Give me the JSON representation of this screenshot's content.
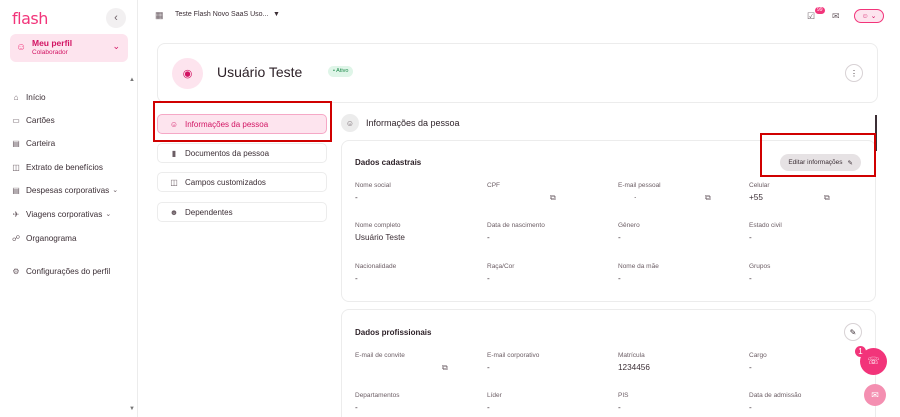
{
  "sidebar": {
    "logo": "flash",
    "collapse_icon": "‹",
    "profile": {
      "name": "Meu perfil",
      "role": "Colaborador"
    },
    "items": [
      {
        "label": "Início",
        "icon": "home-icon"
      },
      {
        "label": "Cartões",
        "icon": "card-icon"
      },
      {
        "label": "Carteira",
        "icon": "wallet-icon"
      },
      {
        "label": "Extrato de benefícios",
        "icon": "statement-icon"
      },
      {
        "label": "Despesas corporativas",
        "icon": "receipt-icon"
      },
      {
        "label": "Viagens corporativas",
        "icon": "plane-icon"
      },
      {
        "label": "Organograma",
        "icon": "org-chart-icon"
      },
      {
        "label": "Configurações do perfil",
        "icon": "gear-icon"
      }
    ]
  },
  "topbar": {
    "company": "Teste Flash Novo SaaS Uso...",
    "tasks_badge": "99"
  },
  "header": {
    "user_name": "Usuário Teste",
    "status": "Ativo"
  },
  "tabs": [
    {
      "label": "Informações da pessoa"
    },
    {
      "label": "Documentos da pessoa"
    },
    {
      "label": "Campos customizados"
    },
    {
      "label": "Dependentes"
    }
  ],
  "section_title": "Informações da pessoa",
  "dados_cadastrais": {
    "title": "Dados cadastrais",
    "edit_label": "Editar informações",
    "fields": [
      {
        "label": "Nome social",
        "value": "-"
      },
      {
        "label": "CPF",
        "value": ""
      },
      {
        "label": "E-mail pessoal",
        "value": "."
      },
      {
        "label": "Celular",
        "value": "+55"
      },
      {
        "label": "Nome completo",
        "value": "Usuário Teste"
      },
      {
        "label": "Data de nascimento",
        "value": "-"
      },
      {
        "label": "Gênero",
        "value": "-"
      },
      {
        "label": "Estado civil",
        "value": "-"
      },
      {
        "label": "Nacionalidade",
        "value": "-"
      },
      {
        "label": "Raça/Cor",
        "value": "-"
      },
      {
        "label": "Nome da mãe",
        "value": "-"
      },
      {
        "label": "Grupos",
        "value": "-"
      }
    ]
  },
  "dados_profissionais": {
    "title": "Dados profissionais",
    "fields": [
      {
        "label": "E-mail de convite",
        "value": ""
      },
      {
        "label": "E-mail corporativo",
        "value": "-"
      },
      {
        "label": "Matrícula",
        "value": "1234456"
      },
      {
        "label": "Cargo",
        "value": "-"
      },
      {
        "label": "Departamentos",
        "value": "-"
      },
      {
        "label": "Líder",
        "value": "-"
      },
      {
        "label": "PIS",
        "value": "-"
      },
      {
        "label": "Data de admissão",
        "value": "-"
      }
    ]
  },
  "support": {
    "count": "1"
  },
  "colors": {
    "brand": "#f2347a",
    "brand_light": "#fde4ee",
    "highlight": "#d00000"
  }
}
